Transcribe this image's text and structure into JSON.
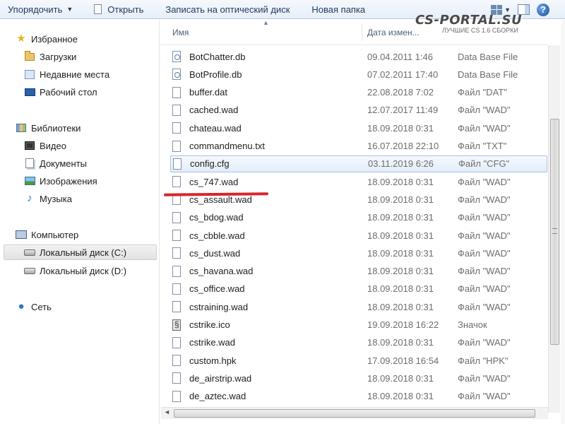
{
  "toolbar": {
    "organize_label": "Упорядочить",
    "open_label": "Открыть",
    "burn_label": "Записать на оптический диск",
    "new_folder_label": "Новая папка",
    "help_label": "?"
  },
  "watermark": {
    "logo": "CS-PORTAL.SU",
    "subtitle": "ЛУЧШИЕ CS 1.6 СБОРКИ"
  },
  "nav": {
    "favorites": "Избранное",
    "downloads": "Загрузки",
    "recent": "Недавние места",
    "desktop": "Рабочий стол",
    "libraries": "Библиотеки",
    "video": "Видео",
    "documents": "Документы",
    "images": "Изображения",
    "music": "Музыка",
    "computer": "Компьютер",
    "disk_c": "Локальный диск (C:)",
    "disk_d": "Локальный диск (D:)",
    "network": "Сеть"
  },
  "columns": {
    "name": "Имя",
    "date": "Дата измен..."
  },
  "files": [
    {
      "name": "BotChatter.db",
      "date": "09.04.2011 1:46",
      "type": "Data Base File",
      "icon": "db"
    },
    {
      "name": "BotProfile.db",
      "date": "07.02.2011 17:40",
      "type": "Data Base File",
      "icon": "db"
    },
    {
      "name": "buffer.dat",
      "date": "22.08.2018 7:02",
      "type": "Файл \"DAT\"",
      "icon": "file"
    },
    {
      "name": "cached.wad",
      "date": "12.07.2017 11:49",
      "type": "Файл \"WAD\"",
      "icon": "file"
    },
    {
      "name": "chateau.wad",
      "date": "18.09.2018 0:31",
      "type": "Файл \"WAD\"",
      "icon": "file"
    },
    {
      "name": "commandmenu.txt",
      "date": "16.07.2018 22:10",
      "type": "Файл \"TXT\"",
      "icon": "file"
    },
    {
      "name": "config.cfg",
      "date": "03.11.2019 6:26",
      "type": "Файл \"CFG\"",
      "icon": "cfg",
      "highlighted": true
    },
    {
      "name": "cs_747.wad",
      "date": "18.09.2018 0:31",
      "type": "Файл \"WAD\"",
      "icon": "file"
    },
    {
      "name": "cs_assault.wad",
      "date": "18.09.2018 0:31",
      "type": "Файл \"WAD\"",
      "icon": "file"
    },
    {
      "name": "cs_bdog.wad",
      "date": "18.09.2018 0:31",
      "type": "Файл \"WAD\"",
      "icon": "file"
    },
    {
      "name": "cs_cbble.wad",
      "date": "18.09.2018 0:31",
      "type": "Файл \"WAD\"",
      "icon": "file"
    },
    {
      "name": "cs_dust.wad",
      "date": "18.09.2018 0:31",
      "type": "Файл \"WAD\"",
      "icon": "file"
    },
    {
      "name": "cs_havana.wad",
      "date": "18.09.2018 0:31",
      "type": "Файл \"WAD\"",
      "icon": "file"
    },
    {
      "name": "cs_office.wad",
      "date": "18.09.2018 0:31",
      "type": "Файл \"WAD\"",
      "icon": "file"
    },
    {
      "name": "cstraining.wad",
      "date": "18.09.2018 0:31",
      "type": "Файл \"WAD\"",
      "icon": "file"
    },
    {
      "name": "cstrike.ico",
      "date": "19.09.2018 16:22",
      "type": "Значок",
      "icon": "ico"
    },
    {
      "name": "cstrike.wad",
      "date": "18.09.2018 0:31",
      "type": "Файл \"WAD\"",
      "icon": "file"
    },
    {
      "name": "custom.hpk",
      "date": "17.09.2018 16:54",
      "type": "Файл \"HPK\"",
      "icon": "file"
    },
    {
      "name": "de_airstrip.wad",
      "date": "18.09.2018 0:31",
      "type": "Файл \"WAD\"",
      "icon": "file"
    },
    {
      "name": "de_aztec.wad",
      "date": "18.09.2018 0:31",
      "type": "Файл \"WAD\"",
      "icon": "file"
    }
  ],
  "colors": {
    "highlight_mark": "#d6262a",
    "selection_border": "#a8c4e3"
  }
}
